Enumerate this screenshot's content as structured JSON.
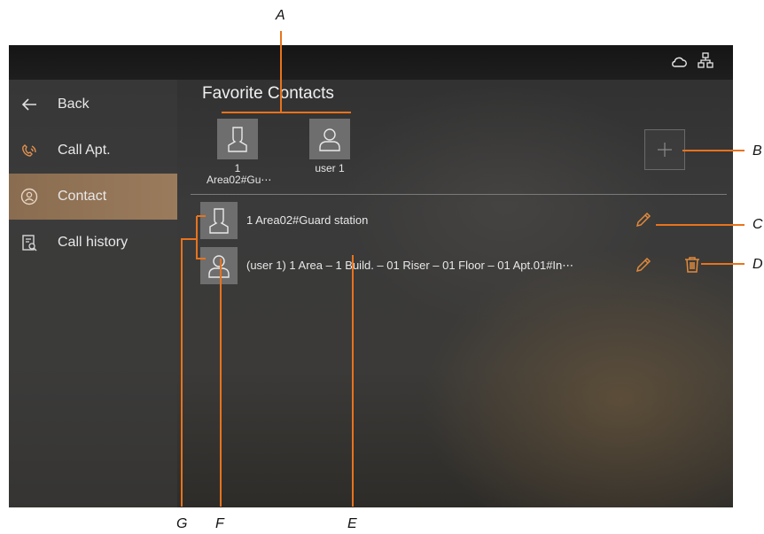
{
  "sidebar": {
    "items": [
      {
        "label": "Back",
        "icon": "back-arrow-icon"
      },
      {
        "label": "Call Apt.",
        "icon": "phone-handset-icon"
      },
      {
        "label": "Contact",
        "icon": "contact-person-icon",
        "active": true
      },
      {
        "label": "Call history",
        "icon": "call-history-icon"
      }
    ]
  },
  "status_icons": [
    "cloud-icon",
    "network-icon"
  ],
  "main": {
    "title": "Favorite Contacts",
    "favorites": [
      {
        "label_line1": "1",
        "label_line2": "Area02#Gu⋯",
        "icon": "guard-station-icon"
      },
      {
        "label_line1": "user 1",
        "label_line2": "",
        "icon": "user-avatar-icon"
      }
    ],
    "add_icon": "plus-icon",
    "contacts": [
      {
        "label": "1 Area02#Guard station",
        "icon": "guard-station-icon",
        "actions": [
          "edit"
        ]
      },
      {
        "label": "(user 1) 1 Area – 1 Build. – 01 Riser – 01 Floor – 01 Apt.01#In⋯",
        "icon": "user-avatar-icon",
        "actions": [
          "edit",
          "delete"
        ]
      }
    ]
  },
  "callouts": {
    "A": "A",
    "B": "B",
    "C": "C",
    "D": "D",
    "E": "E",
    "F": "F",
    "G": "G"
  },
  "colors": {
    "accent": "#9a7b5c",
    "callout_line": "#e8731c",
    "icon_orange": "#e08a3c"
  }
}
